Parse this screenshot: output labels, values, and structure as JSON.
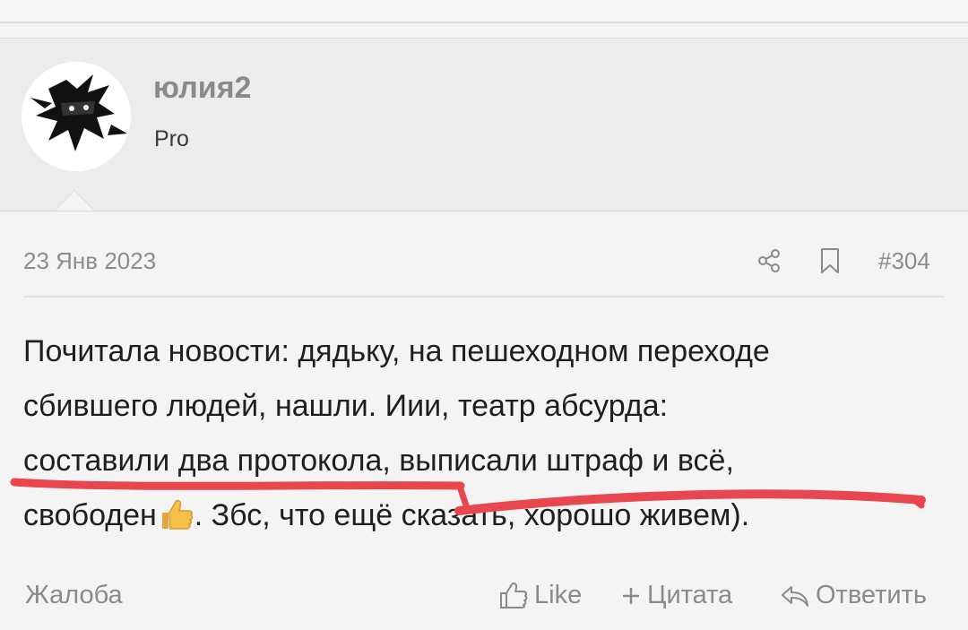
{
  "author": {
    "username": "юлия2",
    "rank": "Pro"
  },
  "post": {
    "date": "23 Янв 2023",
    "number": "#304",
    "lines": [
      "Почитала новости: дядьку, на пешеходном переходе",
      "сбившего людей, нашли. Иии, театр абсурда:",
      "составили два протокола, выписали штраф и всё,",
      "свободен",
      ". Збс, что ещё сказать, хорошо живем)."
    ],
    "emoji": "thumbs-up"
  },
  "icons": {
    "share": "share-icon",
    "bookmark": "bookmark-icon",
    "like": "thumbs-up-icon",
    "quote": "plus-icon",
    "reply": "reply-icon"
  },
  "highlight_color": "#e8474f",
  "actions": {
    "report": "Жалоба",
    "like": "Like",
    "quote": "Цитата",
    "reply": "Ответить"
  }
}
